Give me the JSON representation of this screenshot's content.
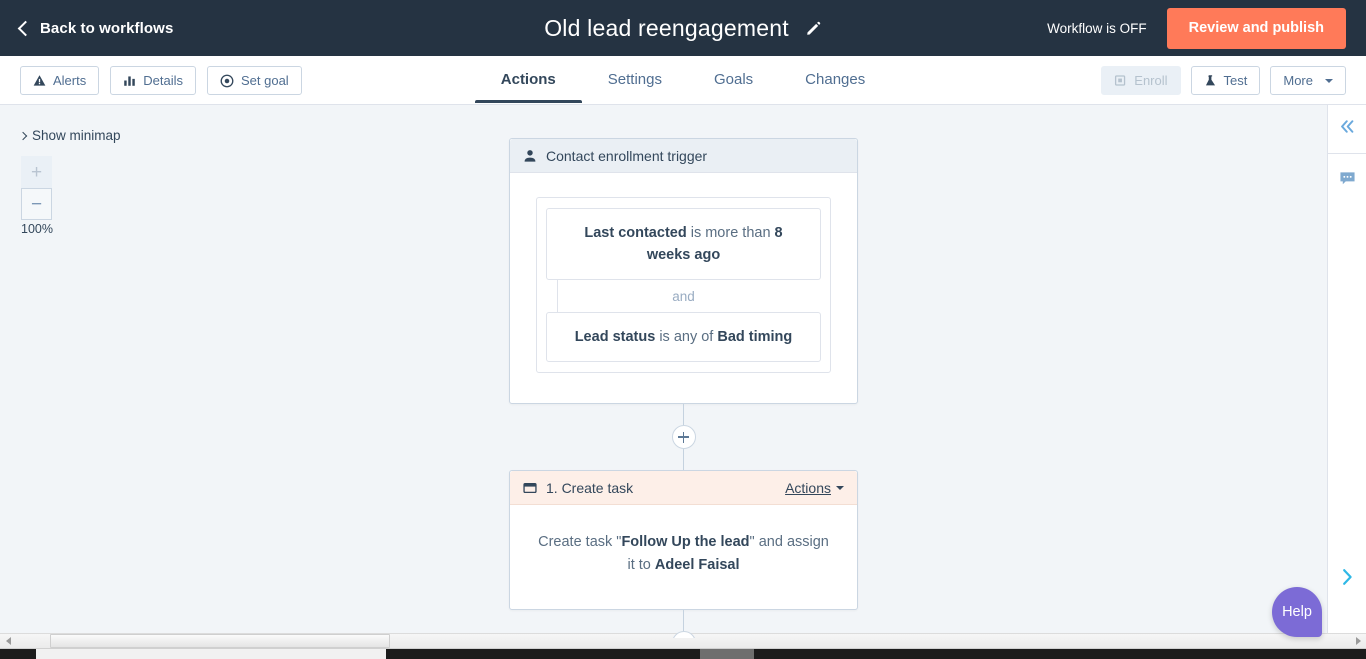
{
  "topnav": {
    "back_label": "Back to workflows",
    "back_icon": "chevron-left-icon",
    "workflow_title": "Old lead reengagement",
    "edit_icon": "pencil-icon",
    "status_text": "Workflow is OFF",
    "publish_label": "Review and publish",
    "publish_color": "#ff7a59",
    "background_color": "#253342"
  },
  "toolbar": {
    "left_buttons": [
      {
        "label": "Alerts",
        "icon": "warning-triangle-icon",
        "disabled": false
      },
      {
        "label": "Details",
        "icon": "bar-chart-icon",
        "disabled": false
      },
      {
        "label": "Set goal",
        "icon": "target-icon",
        "disabled": false
      }
    ],
    "tabs": [
      {
        "label": "Actions",
        "active": true
      },
      {
        "label": "Settings",
        "active": false
      },
      {
        "label": "Goals",
        "active": false
      },
      {
        "label": "Changes",
        "active": false
      }
    ],
    "right_buttons": [
      {
        "label": "Enroll",
        "icon": "enroll-icon",
        "disabled": true
      },
      {
        "label": "Test",
        "icon": "flask-icon",
        "disabled": false
      },
      {
        "label": "More",
        "icon": "caret-down-icon",
        "disabled": false
      }
    ]
  },
  "canvas": {
    "minimap_toggle_label": "Show minimap",
    "minimap_chevron": "chevron-right-icon",
    "zoom_in_label": "+",
    "zoom_out_label": "−",
    "zoom_level": "100%",
    "zoom_in_disabled": true,
    "background_color": "#f2f5f8"
  },
  "flow": {
    "trigger": {
      "header_title": "Contact enrollment trigger",
      "header_icon": "contact-person-icon",
      "header_color": "#eaeff4",
      "filters": [
        {
          "prefix": "",
          "property": "Last contacted",
          "operator": " is more than ",
          "value": "8 weeks ago"
        },
        {
          "prefix": "",
          "property": "Lead status",
          "operator": " is any of ",
          "value": "Bad timing"
        }
      ],
      "join_label": "and"
    },
    "add_step_icon": "plus-circle-icon",
    "actions": [
      {
        "step_label": "1. Create task",
        "header_icon": "task-card-icon",
        "header_color": "#fdefe8",
        "menu_label": "Actions",
        "menu_icon": "caret-down-icon",
        "body_prefix": "Create task \"",
        "body_task_name": "Follow Up the lead",
        "body_middle": "\" and assign it to ",
        "body_assignee": "Adeel Faisal"
      }
    ]
  },
  "right_rail": {
    "collapse_icon": "double-chevron-left-icon",
    "comment_icon": "comment-bubble-icon",
    "expand_icon": "chevron-right-icon"
  },
  "help": {
    "label": "Help",
    "color": "#7c6bd6"
  },
  "scrollbar": {
    "left_arrow_icon": "triangle-left-icon",
    "right_arrow_icon": "triangle-right-icon"
  }
}
